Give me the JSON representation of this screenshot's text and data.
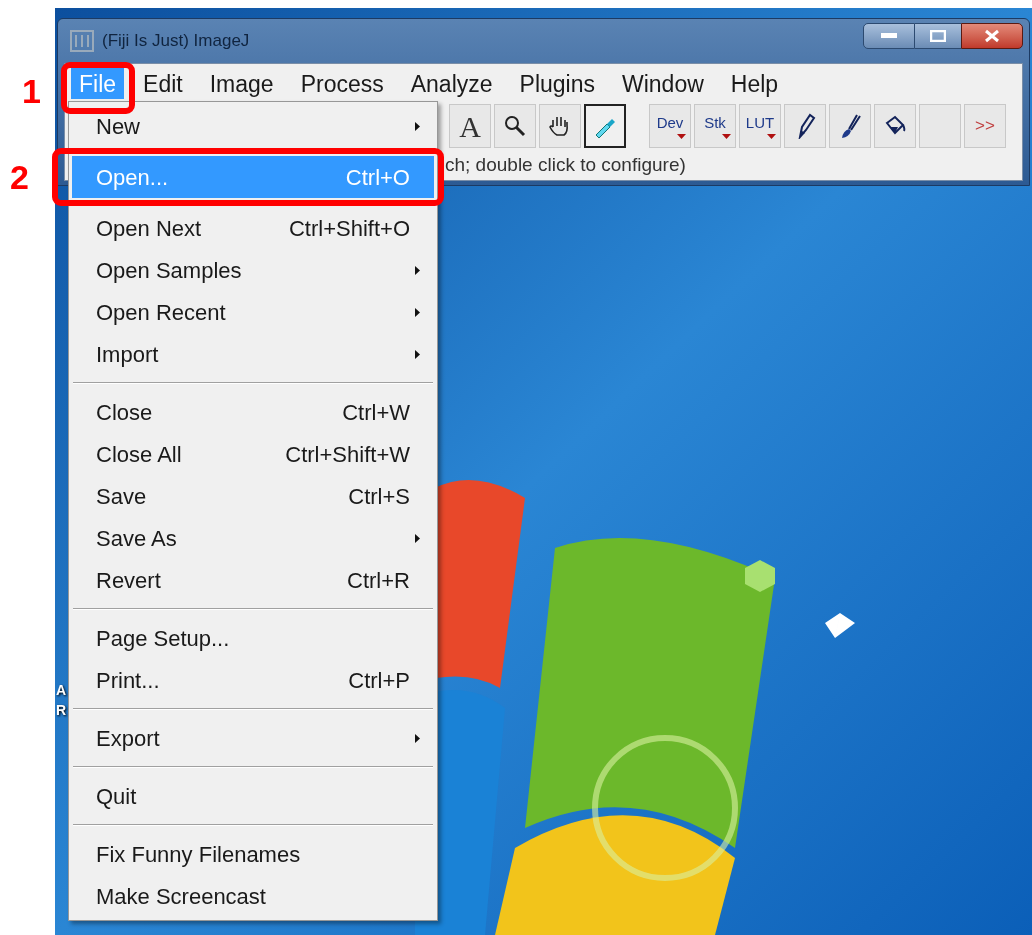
{
  "window": {
    "title": "(Fiji Is Just) ImageJ"
  },
  "menu_bar": [
    {
      "label": "File",
      "selected": true
    },
    {
      "label": "Edit",
      "selected": false
    },
    {
      "label": "Image",
      "selected": false
    },
    {
      "label": "Process",
      "selected": false
    },
    {
      "label": "Analyze",
      "selected": false
    },
    {
      "label": "Plugins",
      "selected": false
    },
    {
      "label": "Window",
      "selected": false
    },
    {
      "label": "Help",
      "selected": false
    }
  ],
  "toolbar": [
    {
      "kind": "text",
      "label": "A",
      "selected": false
    },
    {
      "kind": "magnifier",
      "selected": false
    },
    {
      "kind": "hand",
      "selected": false
    },
    {
      "kind": "dropper",
      "selected": true
    },
    {
      "kind": "gap"
    },
    {
      "kind": "menu",
      "label": "Dev",
      "selected": false
    },
    {
      "kind": "menu",
      "label": "Stk",
      "selected": false
    },
    {
      "kind": "menu",
      "label": "LUT",
      "selected": false
    },
    {
      "kind": "pencil",
      "selected": false
    },
    {
      "kind": "brush",
      "selected": false
    },
    {
      "kind": "bucket",
      "selected": false
    },
    {
      "kind": "blank",
      "selected": false
    },
    {
      "kind": "more",
      "label": ">>",
      "selected": false
    }
  ],
  "status_text": "ch; double click to configure)",
  "file_menu": [
    [
      {
        "label": "New",
        "submenu": true,
        "selected": false
      },
      {
        "label": "Open...",
        "shortcut": "Ctrl+O",
        "submenu": false,
        "selected": true
      },
      {
        "label": "Open Next",
        "shortcut": "Ctrl+Shift+O",
        "submenu": false,
        "selected": false
      },
      {
        "label": "Open Samples",
        "submenu": true,
        "selected": false
      },
      {
        "label": "Open Recent",
        "submenu": true,
        "selected": false
      },
      {
        "label": "Import",
        "submenu": true,
        "selected": false
      }
    ],
    [
      {
        "label": "Close",
        "shortcut": "Ctrl+W",
        "submenu": false,
        "selected": false
      },
      {
        "label": "Close All",
        "shortcut": "Ctrl+Shift+W",
        "submenu": false,
        "selected": false
      },
      {
        "label": "Save",
        "shortcut": "Ctrl+S",
        "submenu": false,
        "selected": false
      },
      {
        "label": "Save As",
        "submenu": true,
        "selected": false
      },
      {
        "label": "Revert",
        "shortcut": "Ctrl+R",
        "submenu": false,
        "selected": false
      }
    ],
    [
      {
        "label": "Page Setup...",
        "submenu": false,
        "selected": false
      },
      {
        "label": "Print...",
        "shortcut": "Ctrl+P",
        "submenu": false,
        "selected": false
      }
    ],
    [
      {
        "label": "Export",
        "submenu": true,
        "selected": false
      }
    ],
    [
      {
        "label": "Quit",
        "submenu": false,
        "selected": false
      }
    ],
    [
      {
        "label": "Fix Funny Filenames",
        "submenu": false,
        "selected": false
      },
      {
        "label": "Make Screencast",
        "submenu": false,
        "selected": false
      }
    ]
  ],
  "desktop_icon_labels": [
    "A",
    "R"
  ],
  "annotations": [
    {
      "label": "1"
    },
    {
      "label": "2"
    }
  ]
}
